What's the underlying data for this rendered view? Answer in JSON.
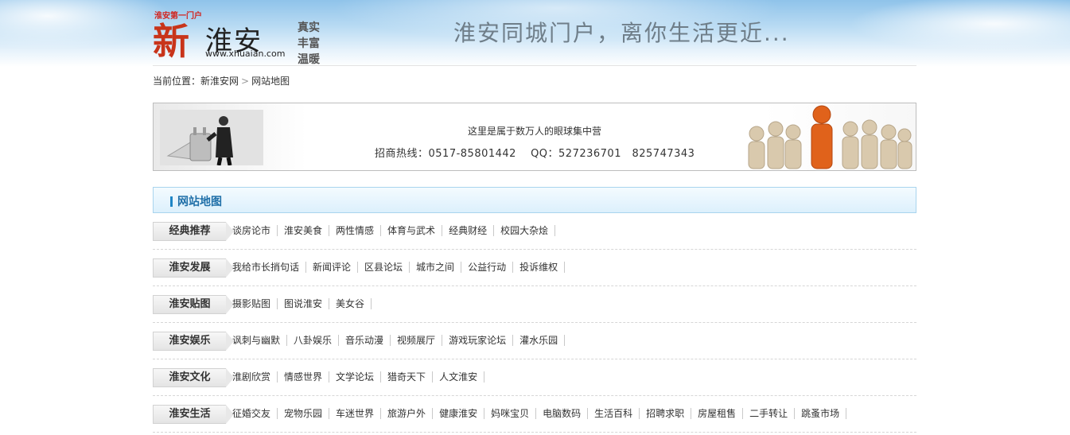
{
  "header": {
    "logo_tag": "淮安第一门户",
    "logo_xin": "新",
    "logo_huaian": "淮安",
    "logo_url": "www.xhuaian.com",
    "slogan_vertical": "真实丰富温暖",
    "slogan": "淮安同城门户，离你生活更近..."
  },
  "breadcrumb": {
    "prefix": "当前位置：",
    "home": "新淮安网",
    "separator": ">",
    "current": "网站地图"
  },
  "banner": {
    "line1": "这里是属于数万人的眼球集中营",
    "line2": "招商热线：0517-85801442　 QQ：527236701　825747343"
  },
  "section": {
    "title": "网站地图"
  },
  "categories": [
    {
      "name": "经典推荐",
      "links": [
        "谈房论市",
        "淮安美食",
        "两性情感",
        "体育与武术",
        "经典财经",
        "校园大杂烩"
      ]
    },
    {
      "name": "淮安发展",
      "links": [
        "我给市长捎句话",
        "新闻评论",
        "区县论坛",
        "城市之间",
        "公益行动",
        "投诉维权"
      ]
    },
    {
      "name": "淮安贴图",
      "links": [
        "摄影贴图",
        "图说淮安",
        "美女谷"
      ]
    },
    {
      "name": "淮安娱乐",
      "links": [
        "讽刺与幽默",
        "八卦娱乐",
        "音乐动漫",
        "视频展厅",
        "游戏玩家论坛",
        "灌水乐园"
      ]
    },
    {
      "name": "淮安文化",
      "links": [
        "淮剧欣赏",
        "情感世界",
        "文学论坛",
        "猎奇天下",
        "人文淮安"
      ]
    },
    {
      "name": "淮安生活",
      "links": [
        "征婚交友",
        "宠物乐园",
        "车迷世界",
        "旅游户外",
        "健康淮安",
        "妈咪宝贝",
        "电脑数码",
        "生活百科",
        "招聘求职",
        "房屋租售",
        "二手转让",
        "跳蚤市场"
      ]
    }
  ],
  "colors": {
    "accent": "#1f86c6",
    "section_title": "#1f6fa8",
    "logo_red": "#c8341a"
  }
}
